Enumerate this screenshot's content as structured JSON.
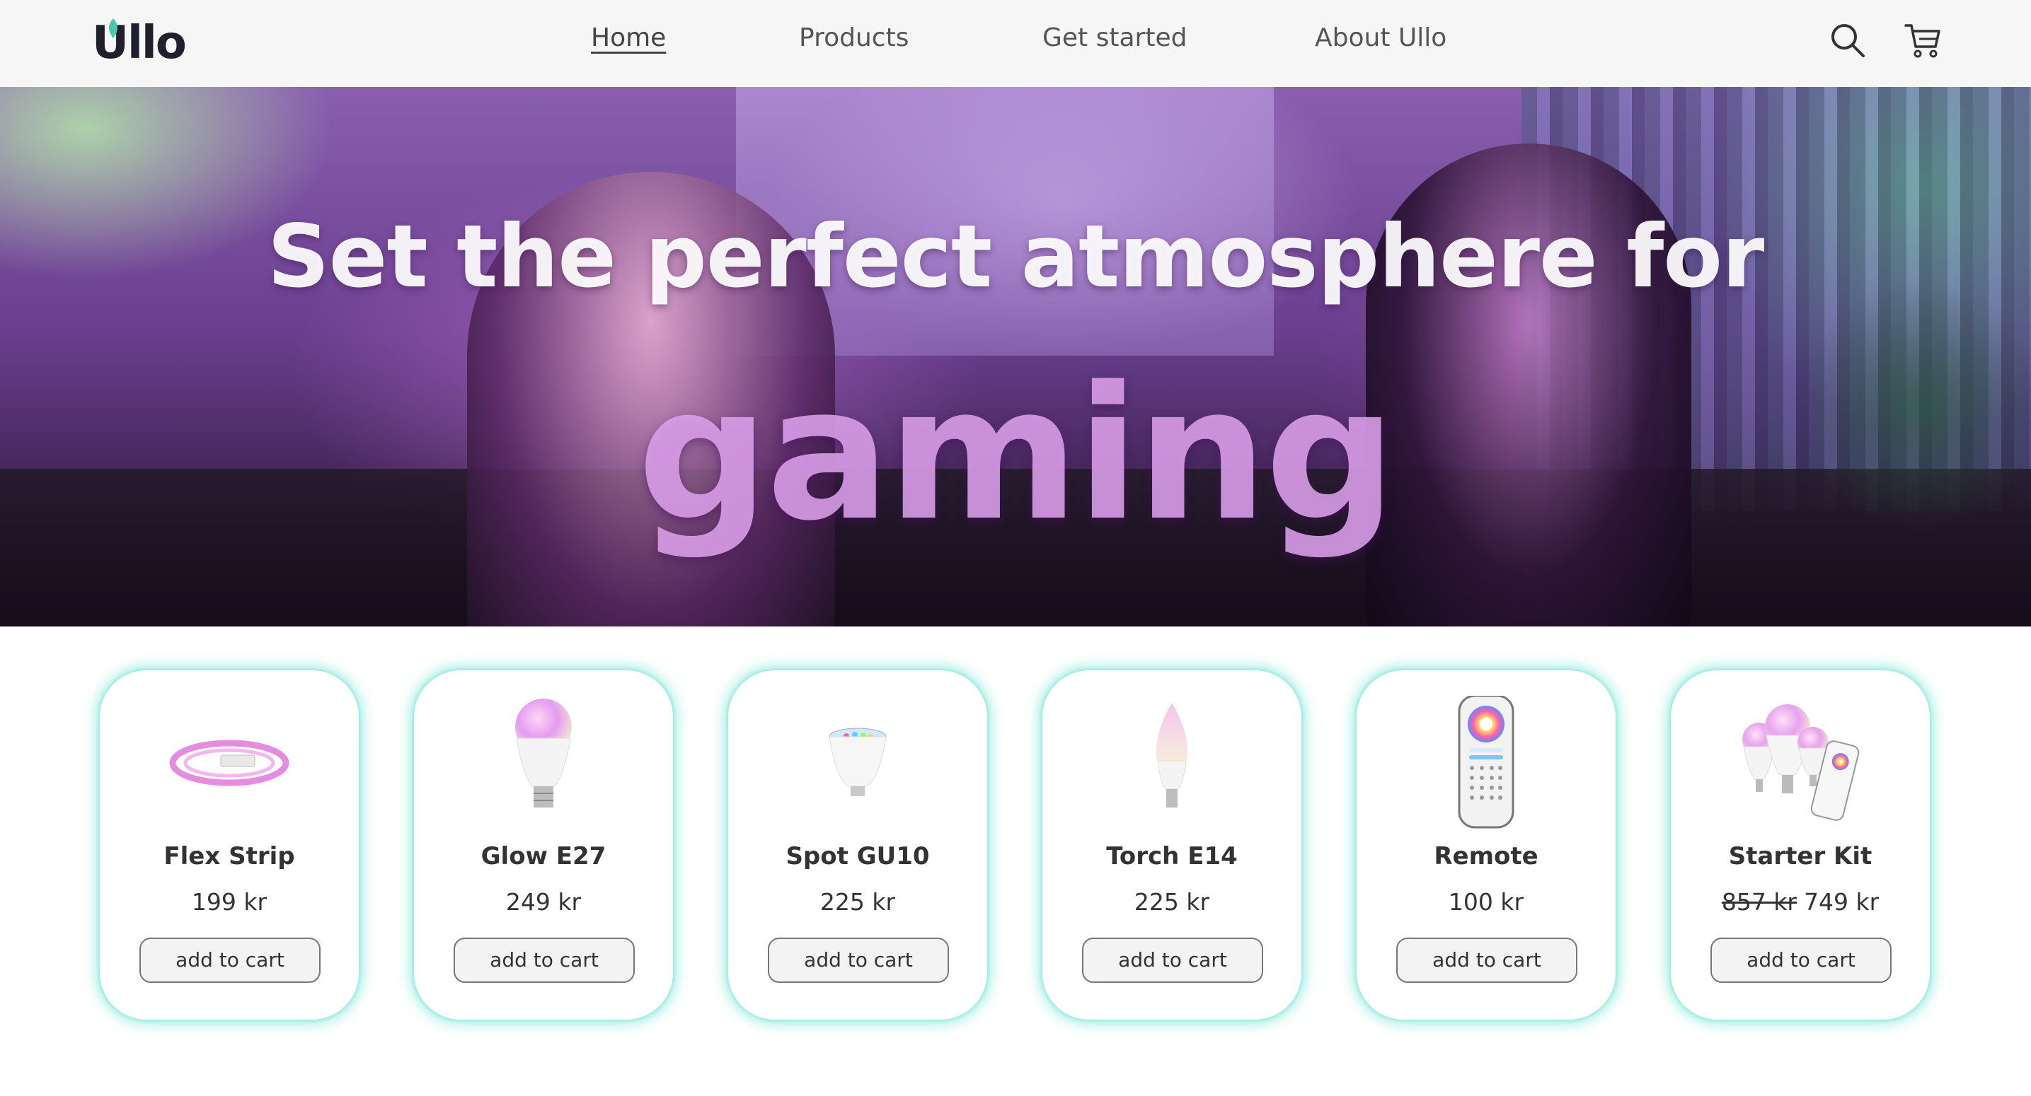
{
  "brand": {
    "logo_text": "Ullo",
    "accent_color": "#4cc9a8",
    "glow_color": "#7ae6d7"
  },
  "nav": {
    "links": [
      {
        "label": "Home",
        "active": true
      },
      {
        "label": "Products",
        "active": false
      },
      {
        "label": "Get started",
        "active": false
      },
      {
        "label": "About Ullo",
        "active": false
      }
    ],
    "icons": [
      "search-icon",
      "cart-icon"
    ]
  },
  "hero": {
    "headline": "Set the perfect atmosphere for",
    "highlight": "gaming"
  },
  "products": [
    {
      "name": "Flex Strip",
      "price": "199 kr",
      "old_price": "",
      "button": "add to cart",
      "icon": "led-strip-image"
    },
    {
      "name": "Glow E27",
      "price": "249 kr",
      "old_price": "",
      "button": "add to cart",
      "icon": "bulb-e27-image"
    },
    {
      "name": "Spot GU10",
      "price": "225 kr",
      "old_price": "",
      "button": "add to cart",
      "icon": "spot-gu10-image"
    },
    {
      "name": "Torch E14",
      "price": "225 kr",
      "old_price": "",
      "button": "add to cart",
      "icon": "candle-e14-image"
    },
    {
      "name": "Remote",
      "price": "100 kr",
      "old_price": "",
      "button": "add to cart",
      "icon": "remote-image"
    },
    {
      "name": "Starter Kit",
      "price": "749 kr",
      "old_price": "857 kr",
      "button": "add to cart",
      "icon": "starter-kit-image"
    }
  ]
}
